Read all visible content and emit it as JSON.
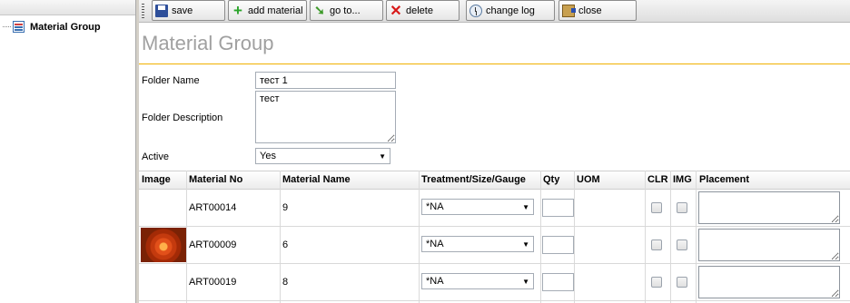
{
  "tree": {
    "item_label": "Material Group"
  },
  "toolbar": {
    "save_label": "save",
    "add_material_label": "add material",
    "goto_label": "go to...",
    "delete_label": "delete",
    "change_log_label": "change log",
    "close_label": "close"
  },
  "page": {
    "title": "Material Group"
  },
  "form": {
    "folder_name_label": "Folder Name",
    "folder_name_value": "тест 1",
    "folder_description_label": "Folder Description",
    "folder_description_value": "тест",
    "active_label": "Active",
    "active_value": "Yes"
  },
  "grid": {
    "columns": [
      "Image",
      "Material No",
      "Material Name",
      "Treatment/Size/Gauge",
      "Qty",
      "UOM",
      "CLR",
      "IMG",
      "Placement"
    ],
    "rows": [
      {
        "material_no": "ART00014",
        "material_name": "9",
        "treatment": "*NA",
        "has_image": false
      },
      {
        "material_no": "ART00009",
        "material_name": "6",
        "treatment": "*NA",
        "has_image": true
      },
      {
        "material_no": "ART00019",
        "material_name": "8",
        "treatment": "*NA",
        "has_image": false
      }
    ]
  },
  "colors": {
    "title_rule": "#f0b000",
    "title_text": "#a0a0a0"
  },
  "icons": {
    "save": "floppy-disk-icon",
    "add": "green-plus-icon",
    "goto": "green-arrow-icon",
    "delete": "red-x-icon",
    "change_log": "clock-icon",
    "close": "door-exit-icon"
  }
}
